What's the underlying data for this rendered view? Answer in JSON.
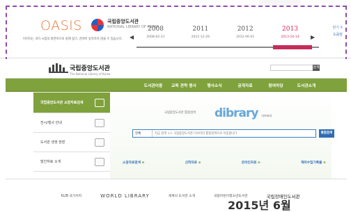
{
  "oasis": {
    "logo": "OASIS",
    "library_name": "국립중앙도서관",
    "library_subname": "NATIONAL LIBRARY OF KOREA",
    "description": "이미지는 과거 시점의 화면이므로 실제 링크, 검색이 동작하지 않을 수 있습니다.",
    "prev_arrow": "◀",
    "next_arrow": "▶",
    "years": [
      {
        "year": "2008",
        "date": "2008-02-21"
      },
      {
        "year": "2011",
        "date": "2011-12-29"
      },
      {
        "year": "2012",
        "date": "2012-06-01"
      },
      {
        "year": "2013",
        "date": "2013-10-14"
      }
    ],
    "side_links": [
      "닫기 X",
      "도움말"
    ]
  },
  "library": {
    "logo": "국립중앙도서관",
    "logo_sub": "The National Library of Korea",
    "search_button": "검색",
    "nav": [
      "도서관이용",
      "교육 견학 봉사",
      "행사소식",
      "공개자료",
      "참여마당",
      "도서관소개"
    ],
    "side": [
      "국립중앙도서관 소장자료검색",
      "전시/행사 안내",
      "도서관 생생 현장",
      "발간자료 소개"
    ],
    "dlib_label": "국립중앙도서관 통합검색",
    "dlib_name": "dibrary",
    "dlib_sub": "디브러리",
    "search_select": "전체",
    "search_placeholder": "지금 검색 >> 국립중앙도서관 디브러리 통합검색으로 이동합니다",
    "search_btn": "통합검색",
    "quick": [
      "소장자료검색",
      "신착자료",
      "온라인자료",
      "해외수집기록물"
    ],
    "banners": [
      "KLIB 국가서지",
      "WORLD LIBRARY",
      "세계의 도서관 소개",
      "국립어린이청소년도서관",
      "국립장애인도서관"
    ]
  },
  "caption": "2015년 6월"
}
